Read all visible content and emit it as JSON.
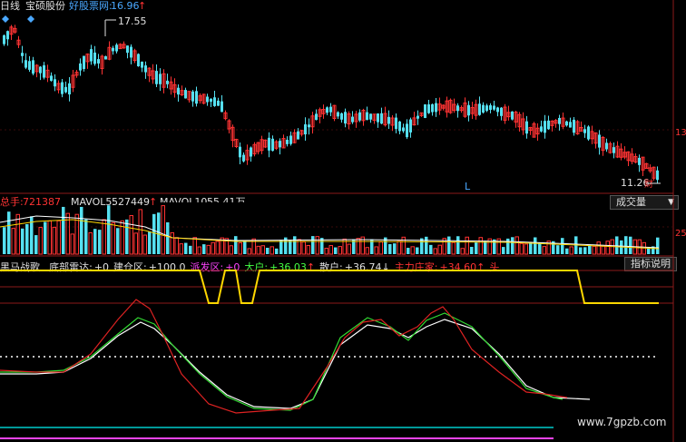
{
  "header": {
    "period": "日线",
    "stock_name": "宝硕股份",
    "site": "好股票网:",
    "price": "16.96",
    "price_arrow": "↑"
  },
  "price_panel": {
    "high_marker": "17.55",
    "low_marker": "11.26",
    "low_marker_suffix": "财",
    "l_marker": "L",
    "right_tick": "13"
  },
  "volume_panel": {
    "total_label": "总手:",
    "total_value": "721387",
    "mavol5_label": "MAVOL5:",
    "mavol5_value": "527449",
    "mavol10_label": "MAVOL10:",
    "mavol10_value": "55.41万",
    "dropdown_label": "成交量",
    "right_tick": "25"
  },
  "indicator_panel": {
    "name": "黑马战歌",
    "items": [
      {
        "label": "底部雷达:",
        "value": "+0",
        "color": "#e0e0e0"
      },
      {
        "label": "建仓区:",
        "value": "+100.0",
        "color": "#e0e0e0"
      },
      {
        "label": "派发区:",
        "value": "+0",
        "color": "#ff44ff"
      },
      {
        "label": "大户:",
        "value": "+36.03",
        "color": "#44ff44",
        "arrow": "↑"
      },
      {
        "label": "散户:",
        "value": "+36.74",
        "color": "#e0e0e0",
        "arrow": "↓"
      },
      {
        "label": "主力庄家:",
        "value": "+34.60",
        "color": "#ff3333",
        "arrow": "↑"
      },
      {
        "label": "头",
        "value": "",
        "color": "#ff3333"
      }
    ],
    "explain_button": "指标说明"
  },
  "watermark": "www.7gpzb.com",
  "colors": {
    "up": "#ff3333",
    "down": "#55e0f0",
    "yellow": "#ffd700",
    "white": "#ffffff",
    "green": "#33dd33",
    "red": "#dd2222"
  }
}
